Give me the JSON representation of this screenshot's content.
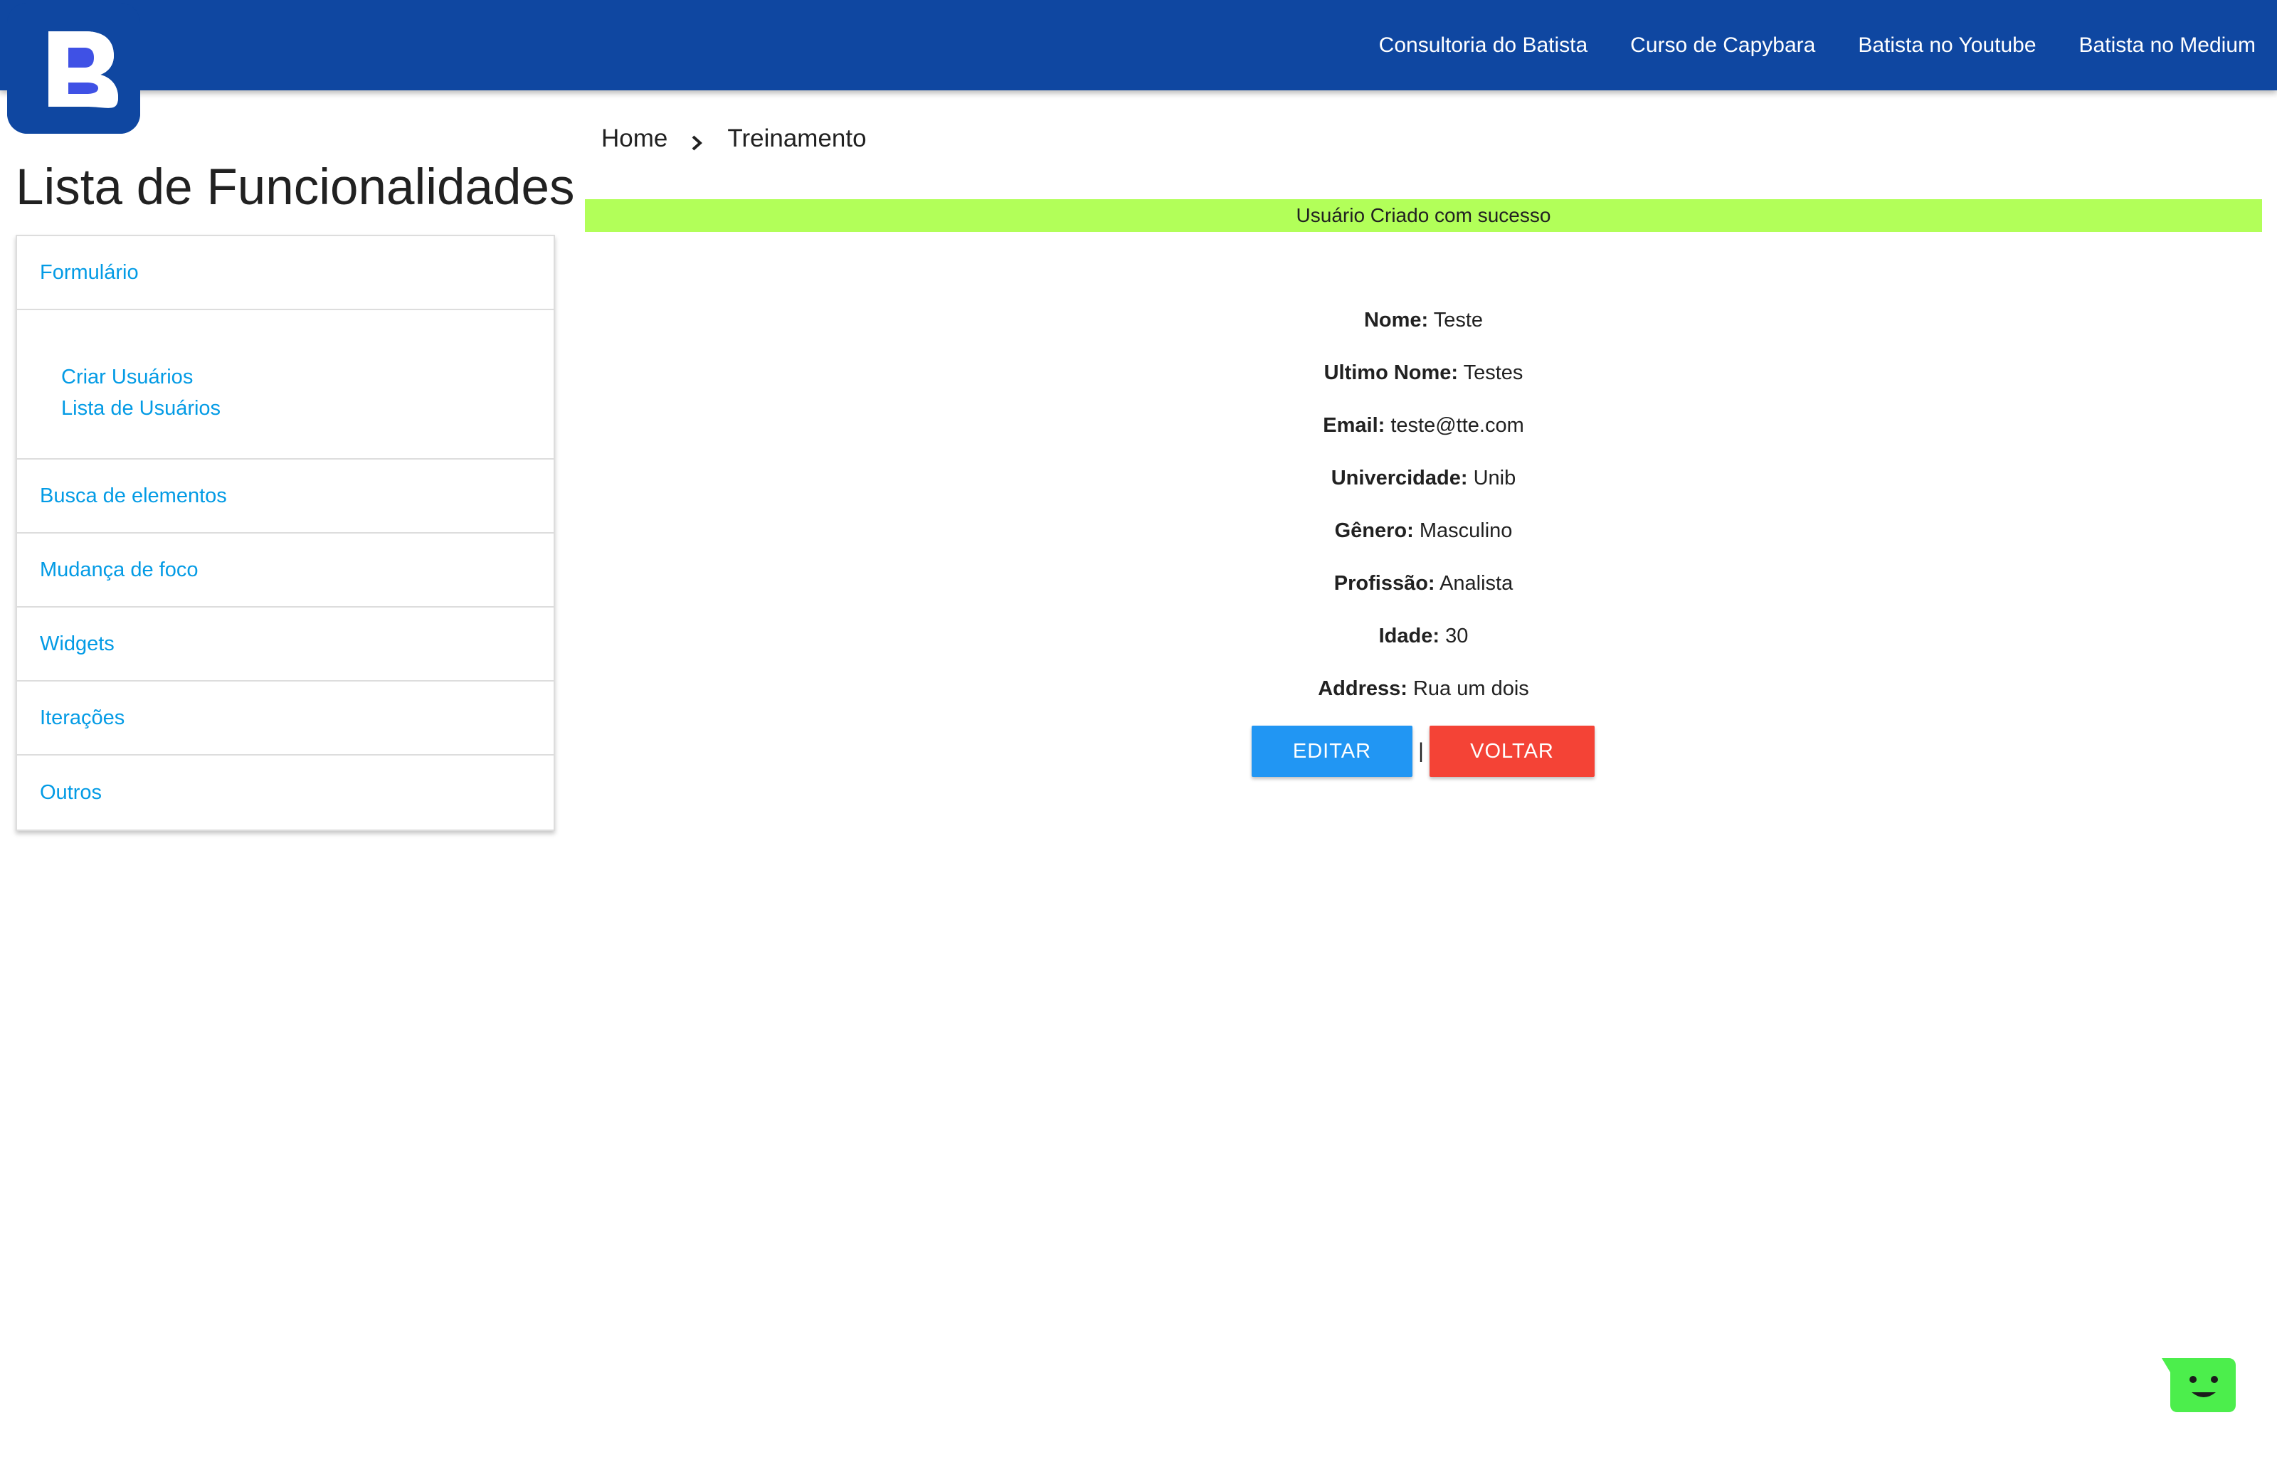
{
  "brand": {
    "logo_letter": "B"
  },
  "nav": {
    "links": [
      "Consultoria do Batista",
      "Curso de Capybara",
      "Batista no Youtube",
      "Batista no Medium"
    ]
  },
  "sidebar": {
    "title": "Lista de Funcionalidades",
    "items": [
      {
        "label": "Formulário",
        "children": [
          "Criar Usuários",
          "Lista de Usuários"
        ]
      },
      {
        "label": "Busca de elementos"
      },
      {
        "label": "Mudança de foco"
      },
      {
        "label": "Widgets"
      },
      {
        "label": "Iterações"
      },
      {
        "label": "Outros"
      }
    ]
  },
  "breadcrumb": {
    "home": "Home",
    "current": "Treinamento"
  },
  "alert": {
    "text": "Usuário Criado com sucesso",
    "color": "#b2ff59"
  },
  "user": {
    "fields": [
      {
        "label": "Nome:",
        "value": "Teste"
      },
      {
        "label": "Ultimo Nome:",
        "value": "Testes"
      },
      {
        "label": "Email:",
        "value": "teste@tte.com"
      },
      {
        "label": "Univercidade:",
        "value": "Unib"
      },
      {
        "label": "Gênero:",
        "value": "Masculino"
      },
      {
        "label": "Profissão:",
        "value": "Analista"
      },
      {
        "label": "Idade:",
        "value": "30"
      },
      {
        "label": "Address:",
        "value": "Rua um dois"
      }
    ]
  },
  "actions": {
    "edit_label": "EDITAR",
    "separator": "|",
    "back_label": "VOLTAR"
  },
  "colors": {
    "navbar": "#0f47a1",
    "link": "#039be5",
    "edit_button": "#2196f3",
    "back_button": "#f44336",
    "chat_widget": "#4cee4c"
  },
  "chat_widget": {
    "icon": "smiley-chat-icon"
  }
}
